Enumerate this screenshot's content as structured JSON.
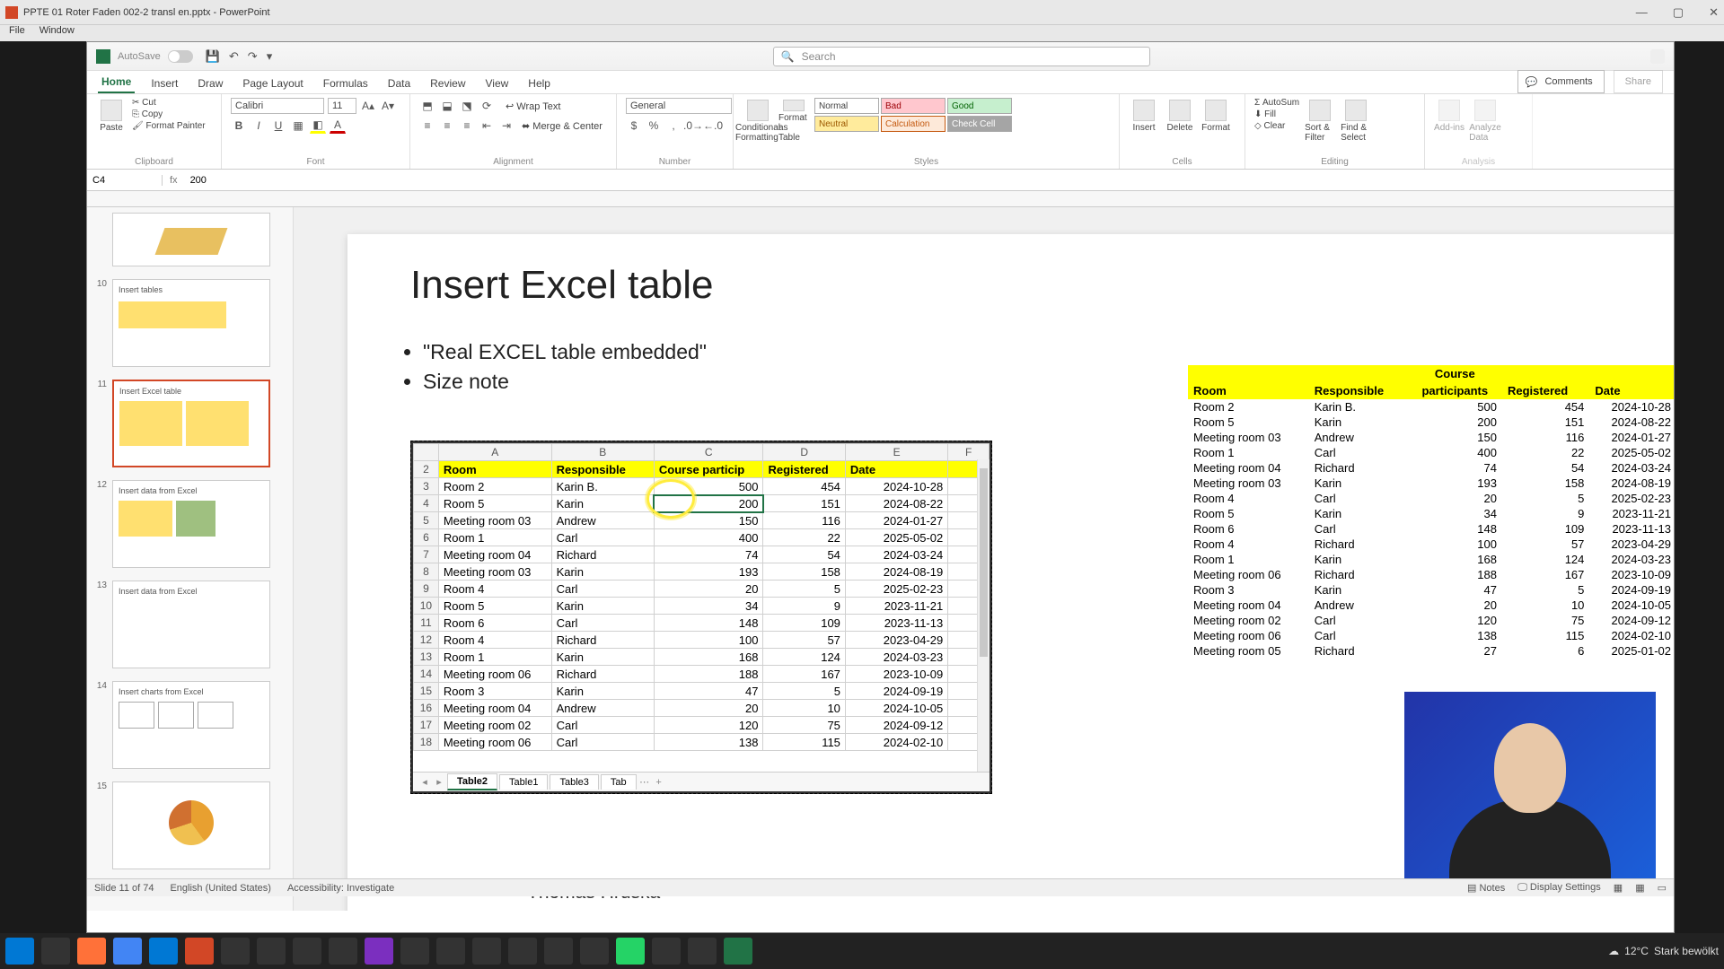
{
  "window": {
    "title": "PPTE 01 Roter Faden 002-2 transl en.pptx - PowerPoint",
    "menus": [
      "File",
      "Window"
    ]
  },
  "excel": {
    "autosave": "AutoSave",
    "search_placeholder": "Search",
    "tabs": [
      "Home",
      "Insert",
      "Draw",
      "Page Layout",
      "Formulas",
      "Data",
      "Review",
      "View",
      "Help"
    ],
    "comments": "Comments",
    "share": "Share",
    "groups": {
      "clipboard": {
        "label": "Clipboard",
        "paste": "Paste",
        "cut": "Cut",
        "copy": "Copy",
        "fp": "Format Painter"
      },
      "font": {
        "label": "Font",
        "name": "Calibri",
        "size": "11"
      },
      "align": {
        "label": "Alignment",
        "wrap": "Wrap Text",
        "merge": "Merge & Center"
      },
      "number": {
        "label": "Number",
        "fmt": "General"
      },
      "styles": {
        "label": "Styles",
        "cf": "Conditional Formatting",
        "ft": "Format as Table",
        "normal": "Normal",
        "bad": "Bad",
        "good": "Good",
        "neutral": "Neutral",
        "calc": "Calculation",
        "check": "Check Cell"
      },
      "cells": {
        "label": "Cells",
        "insert": "Insert",
        "delete": "Delete",
        "format": "Format"
      },
      "editing": {
        "label": "Editing",
        "sum": "AutoSum",
        "fill": "Fill",
        "clear": "Clear",
        "sort": "Sort & Filter",
        "find": "Find & Select"
      },
      "analysis": {
        "label": "Analysis",
        "addins": "Add-ins",
        "analyze": "Analyze Data"
      }
    },
    "namebox": "C4",
    "fx": "fx",
    "fxval": "200"
  },
  "slide": {
    "title": "Insert Excel table",
    "bullets": [
      "\"Real EXCEL table embedded\"",
      "Size note"
    ],
    "author": "Thomas Hruska"
  },
  "thumbs": [
    {
      "n": "10",
      "title": "Insert tables"
    },
    {
      "n": "11",
      "title": "Insert Excel table"
    },
    {
      "n": "12",
      "title": "Insert data from Excel"
    },
    {
      "n": "13",
      "title": "Insert data from Excel"
    },
    {
      "n": "14",
      "title": "Insert charts from Excel"
    },
    {
      "n": "15",
      "title": ""
    }
  ],
  "chart_data": {
    "type": "table",
    "columns": [
      "Room",
      "Responsible",
      "Course particip",
      "Registered",
      "Date"
    ],
    "rows": [
      [
        "Room 2",
        "Karin B.",
        500,
        454,
        "2024-10-28"
      ],
      [
        "Room 5",
        "Karin",
        200,
        151,
        "2024-08-22"
      ],
      [
        "Meeting room 03",
        "Andrew",
        150,
        116,
        "2024-01-27"
      ],
      [
        "Room 1",
        "Carl",
        400,
        22,
        "2025-05-02"
      ],
      [
        "Meeting room 04",
        "Richard",
        74,
        54,
        "2024-03-24"
      ],
      [
        "Meeting room 03",
        "Karin",
        193,
        158,
        "2024-08-19"
      ],
      [
        "Room 4",
        "Carl",
        20,
        5,
        "2025-02-23"
      ],
      [
        "Room 5",
        "Karin",
        34,
        9,
        "2023-11-21"
      ],
      [
        "Room 6",
        "Carl",
        148,
        109,
        "2023-11-13"
      ],
      [
        "Room 4",
        "Richard",
        100,
        57,
        "2023-04-29"
      ],
      [
        "Room 1",
        "Karin",
        168,
        124,
        "2024-03-23"
      ],
      [
        "Meeting room 06",
        "Richard",
        188,
        167,
        "2023-10-09"
      ],
      [
        "Room 3",
        "Karin",
        47,
        5,
        "2024-09-19"
      ],
      [
        "Meeting room 04",
        "Andrew",
        20,
        10,
        "2024-10-05"
      ],
      [
        "Meeting room 02",
        "Carl",
        120,
        75,
        "2024-09-12"
      ],
      [
        "Meeting room 06",
        "Carl",
        138,
        115,
        "2024-02-10"
      ]
    ],
    "row_start": 3,
    "col_letters": [
      "A",
      "B",
      "C",
      "D",
      "E",
      "F"
    ],
    "sheets": [
      "Table2",
      "Table1",
      "Table3",
      "Tab"
    ],
    "selected_cell": "C4"
  },
  "static_table": {
    "columns": [
      "Room",
      "Responsible",
      "Course participants",
      "Registered",
      "Date"
    ],
    "rows": [
      [
        "Room 2",
        "Karin B.",
        500,
        454,
        "2024-10-28"
      ],
      [
        "Room 5",
        "Karin",
        200,
        151,
        "2024-08-22"
      ],
      [
        "Meeting room 03",
        "Andrew",
        150,
        116,
        "2024-01-27"
      ],
      [
        "Room 1",
        "Carl",
        400,
        22,
        "2025-05-02"
      ],
      [
        "Meeting room 04",
        "Richard",
        74,
        54,
        "2024-03-24"
      ],
      [
        "Meeting room 03",
        "Karin",
        193,
        158,
        "2024-08-19"
      ],
      [
        "Room 4",
        "Carl",
        20,
        5,
        "2025-02-23"
      ],
      [
        "Room 5",
        "Karin",
        34,
        9,
        "2023-11-21"
      ],
      [
        "Room 6",
        "Carl",
        148,
        109,
        "2023-11-13"
      ],
      [
        "Room 4",
        "Richard",
        100,
        57,
        "2023-04-29"
      ],
      [
        "Room 1",
        "Karin",
        168,
        124,
        "2024-03-23"
      ],
      [
        "Meeting room 06",
        "Richard",
        188,
        167,
        "2023-10-09"
      ],
      [
        "Room 3",
        "Karin",
        47,
        5,
        "2024-09-19"
      ],
      [
        "Meeting room 04",
        "Andrew",
        20,
        10,
        "2024-10-05"
      ],
      [
        "Meeting room 02",
        "Carl",
        120,
        75,
        "2024-09-12"
      ],
      [
        "Meeting room 06",
        "Carl",
        138,
        115,
        "2024-02-10"
      ],
      [
        "Meeting room 05",
        "Richard",
        27,
        6,
        "2025-01-02"
      ]
    ]
  },
  "status": {
    "slide": "Slide 11 of 74",
    "lang": "English (United States)",
    "acc": "Accessibility: Investigate",
    "notes": "Notes",
    "disp": "Display Settings"
  },
  "weather": {
    "temp": "12°C",
    "cond": "Stark bewölkt"
  }
}
